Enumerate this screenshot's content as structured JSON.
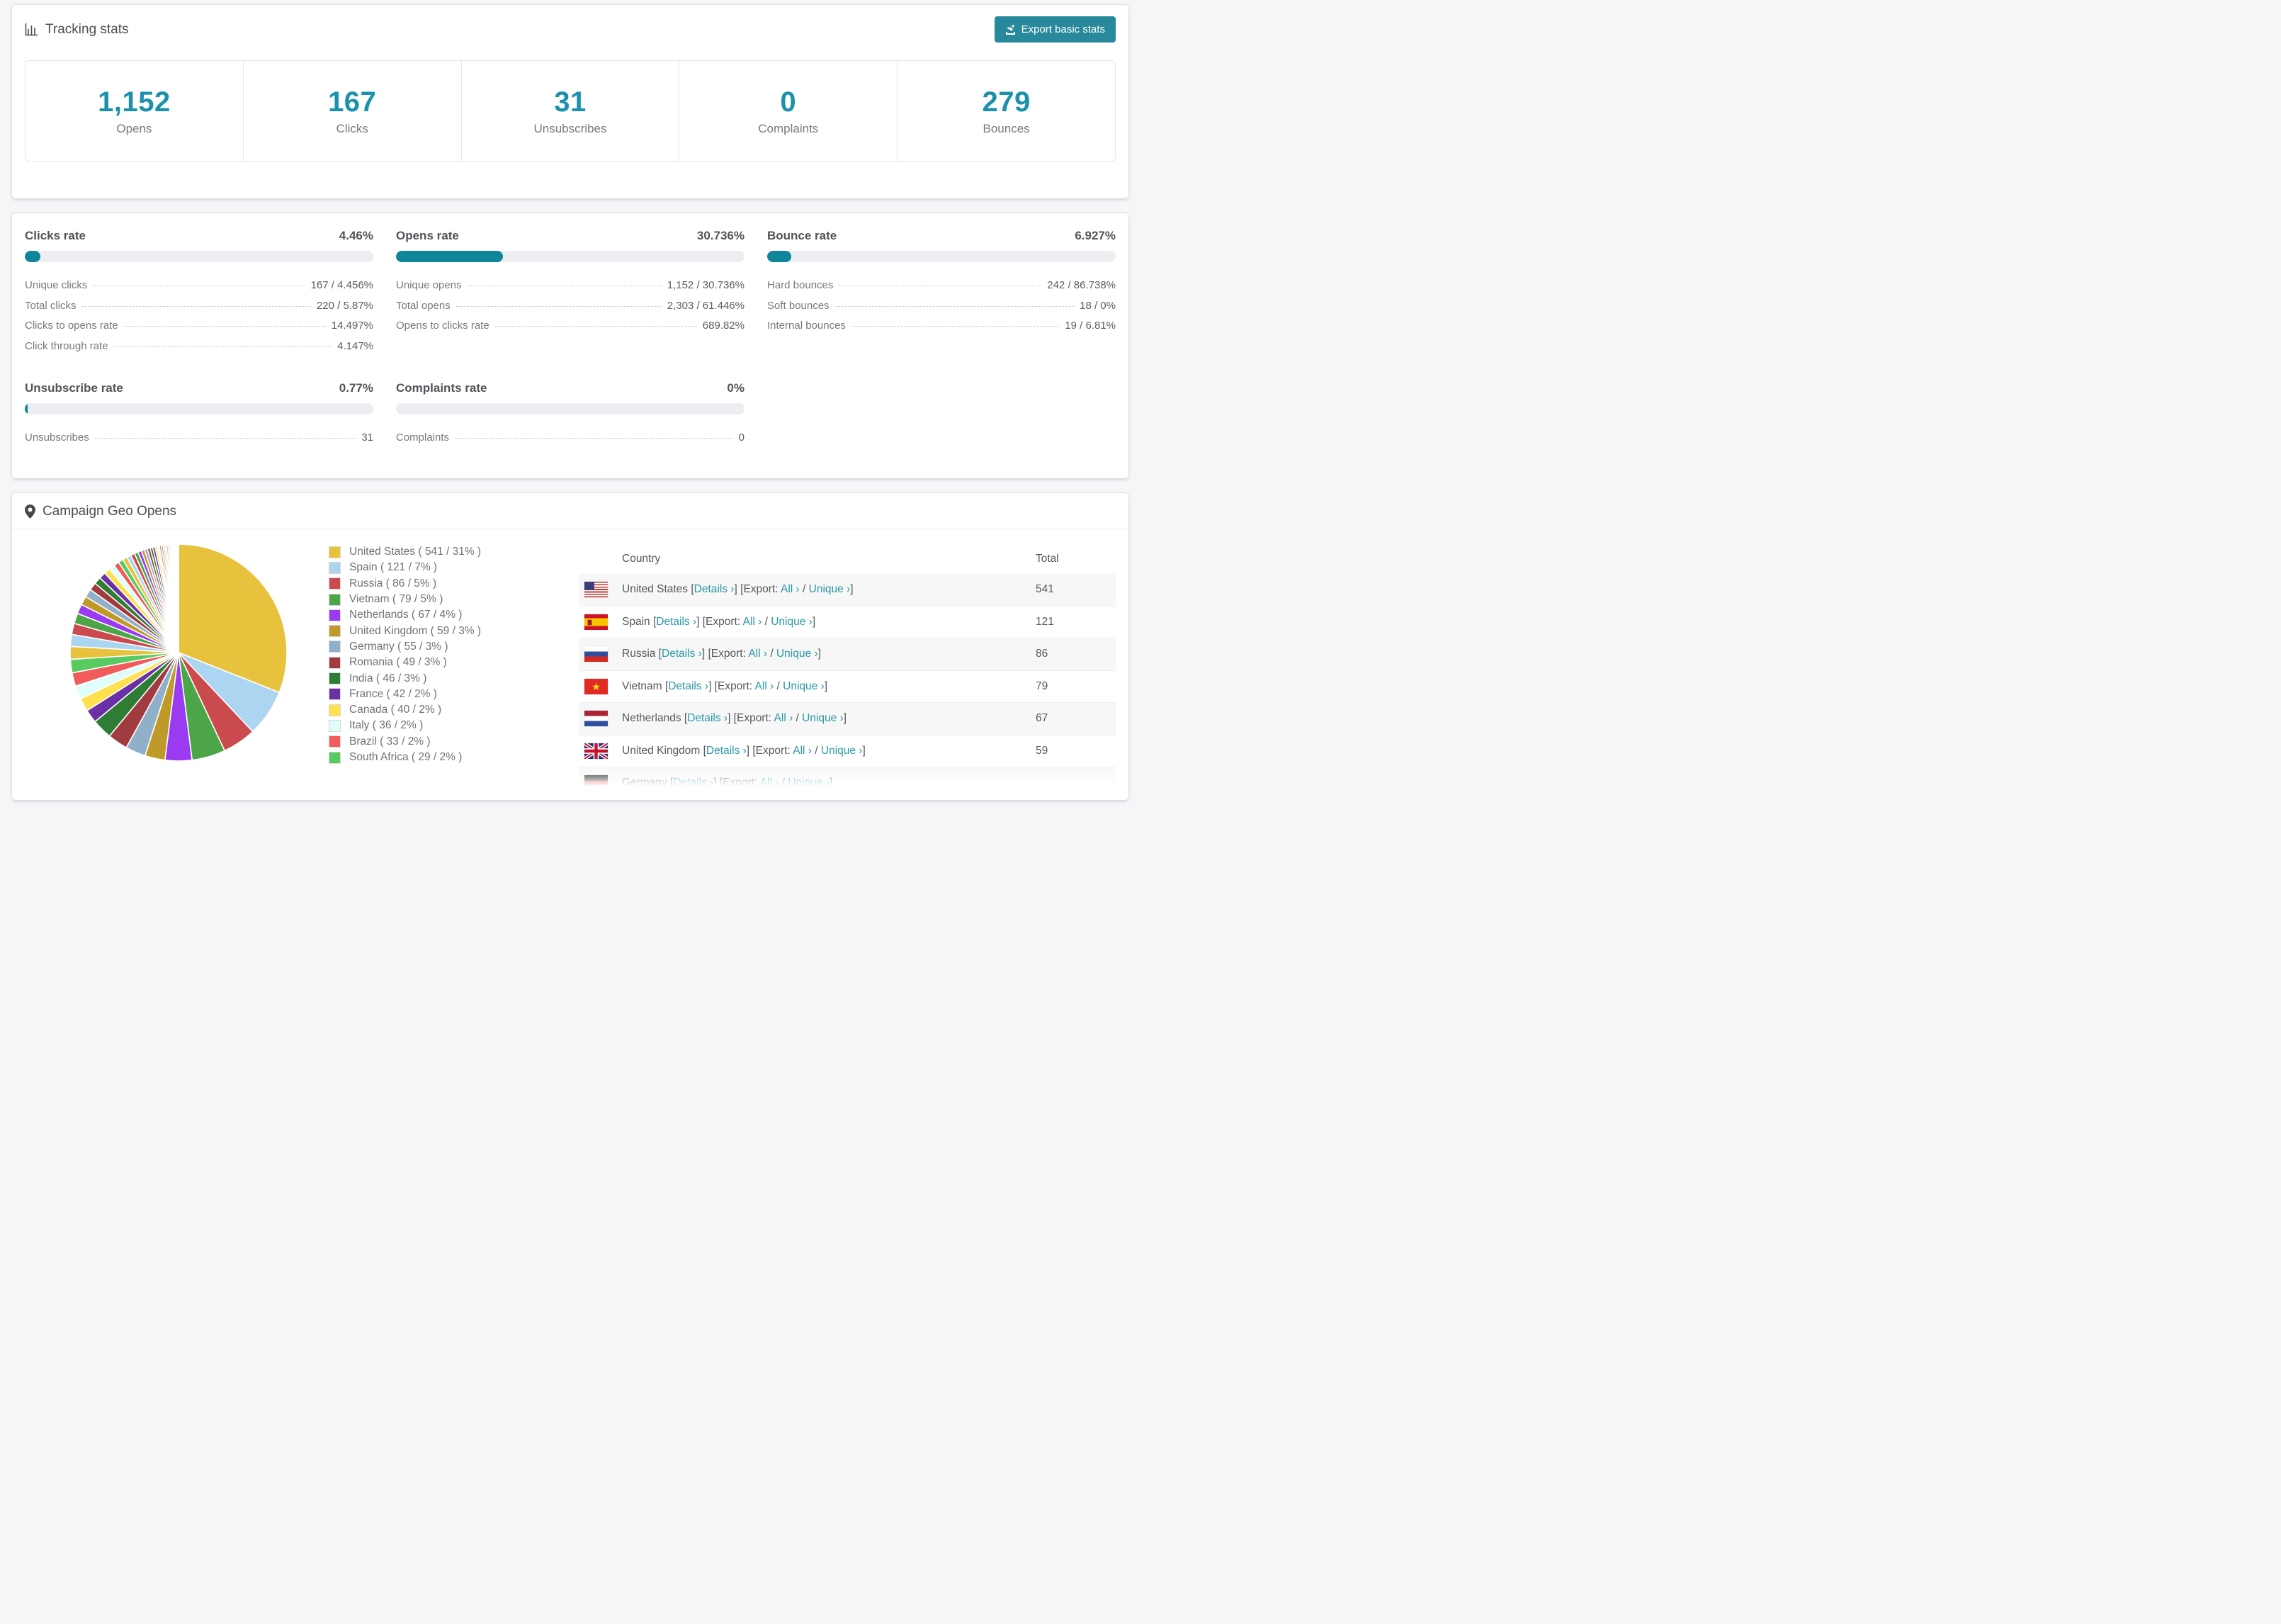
{
  "colors": {
    "accent_teal": "#27899b",
    "stat_number_teal": "#1b91ab",
    "progress_fill_teal": "#0f8599",
    "link_teal": "#2a98a9",
    "page_background": "#f5f6f7"
  },
  "tracking": {
    "title": "Tracking stats",
    "export_button": "Export basic stats",
    "stats": [
      {
        "value": "1,152",
        "label": "Opens"
      },
      {
        "value": "167",
        "label": "Clicks"
      },
      {
        "value": "31",
        "label": "Unsubscribes"
      },
      {
        "value": "0",
        "label": "Complaints"
      },
      {
        "value": "279",
        "label": "Bounces"
      }
    ]
  },
  "rates": {
    "blocks": [
      {
        "title": "Clicks rate",
        "value": "4.46%",
        "bar_pct": 4.46,
        "rows": [
          {
            "label": "Unique clicks",
            "value": "167 / 4.456%"
          },
          {
            "label": "Total clicks",
            "value": "220 / 5.87%"
          },
          {
            "label": "Clicks to opens rate",
            "value": "14.497%"
          },
          {
            "label": "Click through rate",
            "value": "4.147%"
          }
        ]
      },
      {
        "title": "Opens rate",
        "value": "30.736%",
        "bar_pct": 30.736,
        "rows": [
          {
            "label": "Unique opens",
            "value": "1,152 / 30.736%"
          },
          {
            "label": "Total opens",
            "value": "2,303 / 61.446%"
          },
          {
            "label": "Opens to clicks rate",
            "value": "689.82%"
          }
        ]
      },
      {
        "title": "Bounce rate",
        "value": "6.927%",
        "bar_pct": 6.927,
        "rows": [
          {
            "label": "Hard bounces",
            "value": "242 / 86.738%"
          },
          {
            "label": "Soft bounces",
            "value": "18 / 0%"
          },
          {
            "label": "Internal bounces",
            "value": "19 / 6.81%"
          }
        ]
      },
      {
        "title": "Unsubscribe rate",
        "value": "0.77%",
        "bar_pct": 0.77,
        "rows": [
          {
            "label": "Unsubscribes",
            "value": "31"
          }
        ]
      },
      {
        "title": "Complaints rate",
        "value": "0%",
        "bar_pct": 0,
        "rows": [
          {
            "label": "Complaints",
            "value": "0"
          }
        ]
      }
    ]
  },
  "geo": {
    "title": "Campaign Geo Opens",
    "table": {
      "headers": [
        "Country",
        "Total"
      ],
      "link_details": "Details ›",
      "export_prefix": "[Export:",
      "link_all": "All ›",
      "link_unique": "Unique ›",
      "rows": [
        {
          "country": "United States",
          "flag": "us",
          "total": "541"
        },
        {
          "country": "Spain",
          "flag": "es",
          "total": "121"
        },
        {
          "country": "Russia",
          "flag": "ru",
          "total": "86"
        },
        {
          "country": "Vietnam",
          "flag": "vn",
          "total": "79"
        },
        {
          "country": "Netherlands",
          "flag": "nl",
          "total": "67"
        },
        {
          "country": "United Kingdom",
          "flag": "gb",
          "total": "59"
        },
        {
          "country": "Germany",
          "flag": "de",
          "total": ""
        }
      ]
    },
    "chart_data": {
      "type": "pie",
      "title": "Campaign Geo Opens",
      "legend_position": "right",
      "start_angle_deg": -90,
      "slices": [
        {
          "label": "United States",
          "value": 541,
          "pct": 31,
          "color": "#E8C23D"
        },
        {
          "label": "Spain",
          "value": 121,
          "pct": 7,
          "color": "#ABD5F1"
        },
        {
          "label": "Russia",
          "value": 86,
          "pct": 5,
          "color": "#CB4A4E"
        },
        {
          "label": "Vietnam",
          "value": 79,
          "pct": 5,
          "color": "#4CA547"
        },
        {
          "label": "Netherlands",
          "value": 67,
          "pct": 4,
          "color": "#9A3BF2"
        },
        {
          "label": "United Kingdom",
          "value": 59,
          "pct": 3,
          "color": "#C09A28"
        },
        {
          "label": "Germany",
          "value": 55,
          "pct": 3,
          "color": "#90AFC9"
        },
        {
          "label": "Romania",
          "value": 49,
          "pct": 3,
          "color": "#A23B40"
        },
        {
          "label": "India",
          "value": 46,
          "pct": 3,
          "color": "#2F7D34"
        },
        {
          "label": "France",
          "value": 42,
          "pct": 2,
          "color": "#6B2FA6"
        },
        {
          "label": "Canada",
          "value": 40,
          "pct": 2,
          "color": "#FFE14F"
        },
        {
          "label": "Italy",
          "value": 36,
          "pct": 2,
          "color": "#DFFDF9"
        },
        {
          "label": "Brazil",
          "value": 33,
          "pct": 2,
          "color": "#F15B5B"
        },
        {
          "label": "South Africa",
          "value": 29,
          "pct": 2,
          "color": "#58CB60"
        }
      ],
      "other_slices_hint": {
        "count": 42,
        "total_pct": 26,
        "note": "unlabeled small slivers, decaying sizes, palette repeats"
      }
    }
  }
}
